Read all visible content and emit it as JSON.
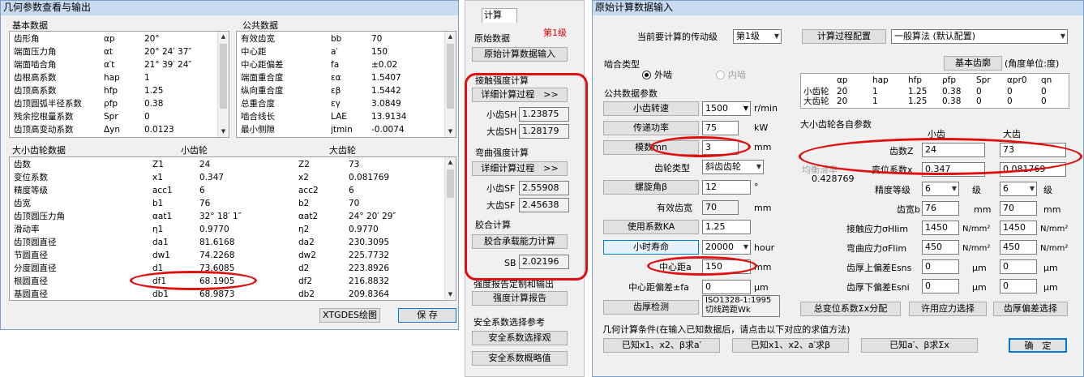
{
  "geo": {
    "title": "几何参数查看与输出",
    "basic_title": "基本数据",
    "basic_rows": [
      [
        "齿形角",
        "αp",
        "20°"
      ],
      [
        "端面压力角",
        "αt",
        "20° 24′ 37″"
      ],
      [
        "端面啮合角",
        "α′t",
        "21° 39′ 24″"
      ],
      [
        "齿根高系数",
        "hap",
        "1"
      ],
      [
        "齿顶高系数",
        "hfp",
        "1.25"
      ],
      [
        "齿顶圆弧半径系数",
        "ρfp",
        "0.38"
      ],
      [
        "残余挖根量系数",
        "Spr",
        "0"
      ],
      [
        "齿顶高变动系数",
        "Δyn",
        "0.0123"
      ]
    ],
    "public_title": "公共数据",
    "public_rows": [
      [
        "有效齿宽",
        "bb",
        "70"
      ],
      [
        "中心距",
        "a′",
        "150"
      ],
      [
        "中心距偏差",
        "fa",
        "±0.02"
      ],
      [
        "端面重合度",
        "εα",
        "1.5407"
      ],
      [
        "纵向重合度",
        "εβ",
        "1.5442"
      ],
      [
        "总重合度",
        "εγ",
        "3.0849"
      ],
      [
        "啮合线长",
        "LAE",
        "13.9134"
      ],
      [
        "最小侧隙",
        "jtmin",
        "-0.0074"
      ]
    ],
    "gear_title": "大小齿轮数据",
    "small_hdr": "小齿轮",
    "large_hdr": "大齿轮",
    "gear_rows": [
      [
        "齿数",
        "Z1",
        "24",
        "Z2",
        "73"
      ],
      [
        "变位系数",
        "x1",
        "0.347",
        "x2",
        "0.081769"
      ],
      [
        "精度等级",
        "acc1",
        "6",
        "acc2",
        "6"
      ],
      [
        "齿宽",
        "b1",
        "76",
        "b2",
        "70"
      ],
      [
        "齿顶圆压力角",
        "αat1",
        "32° 18′ 1″",
        "αat2",
        "24° 20′ 29″"
      ],
      [
        "滑动率",
        "η1",
        "0.9770",
        "η2",
        "0.9770"
      ],
      [
        "齿顶圆直径",
        "da1",
        "81.6168",
        "da2",
        "230.3095"
      ],
      [
        "节圆直径",
        "dw1",
        "74.2268",
        "dw2",
        "225.7732"
      ],
      [
        "分度圆直径",
        "d1",
        "73.6085",
        "d2",
        "223.8926"
      ],
      [
        "根圆直径",
        "df1",
        "68.1905",
        "df2",
        "216.8832"
      ],
      [
        "基圆直径",
        "db1",
        "68.9873",
        "db2",
        "209.8364"
      ]
    ],
    "btn_draw": "XTGDES绘图",
    "btn_save": "保 存"
  },
  "mid": {
    "tab": "计算",
    "level": "第1级",
    "orig_title": "原始数据",
    "orig_btn": "原始计算数据输入",
    "contact_title": "接触强度计算",
    "detail_btn": "详细计算过程　>>",
    "sh_small_lbl": "小齿SH",
    "sh_small": "1.23875",
    "sh_large_lbl": "大齿SH",
    "sh_large": "1.28179",
    "bend_title": "弯曲强度计算",
    "detail_btn2": "详细计算过程　>>",
    "sf_small_lbl": "小齿SF",
    "sf_small": "2.55908",
    "sf_large_lbl": "大齿SF",
    "sf_large": "2.45638",
    "glue_title": "胶合计算",
    "glue_btn": "胶合承载能力计算",
    "sb_lbl": "SB",
    "sb": "2.02196",
    "report_title": "强度报告定制和输出",
    "report_btn": "强度计算报告",
    "safety_title": "安全系数选择参考",
    "safety_btn1": "安全系数选择观",
    "safety_btn2": "安全系数概略值"
  },
  "input": {
    "title": "原始计算数据输入",
    "stage_lbl": "当前要计算的传动级",
    "stage_val": "第1级",
    "config_btn": "计算过程配置",
    "algo_val": "一般算法 (默认配置)",
    "mesh_lbl": "啮合类型",
    "mesh_ext": "外啮",
    "mesh_int": "内啮",
    "rack_btn": "基本齿廓",
    "angle_unit": "(角度单位:度)",
    "rack_hdr": [
      "αp",
      "hap",
      "hfp",
      "ρfp",
      "Spr",
      "αpr0",
      "qn"
    ],
    "rack_small_lbl": "小齿轮",
    "rack_large_lbl": "大齿轮",
    "rack_small": [
      "20",
      "1",
      "1.25",
      "0.38",
      "0",
      "0",
      "0"
    ],
    "rack_large": [
      "20",
      "1",
      "1.25",
      "0.38",
      "0",
      "0",
      "0"
    ],
    "public_title": "公共数据参数",
    "speed_btn": "小齿转速",
    "speed_val": "1500",
    "speed_unit": "r/min",
    "power_btn": "传递功率",
    "power_val": "75",
    "power_unit": "kW",
    "module_btn": "模数mn",
    "module_val": "3",
    "module_unit": "mm",
    "gear_type_lbl": "齿轮类型",
    "gear_type_val": "斜齿齿轮",
    "helix_btn": "螺旋角β",
    "helix_val": "12",
    "helix_unit": "°",
    "face_lbl": "有效齿宽",
    "face_val": "70",
    "face_unit": "mm",
    "ka_btn": "使用系数KA",
    "ka_val": "1.25",
    "life_btn": "小时寿命",
    "life_val": "20000",
    "life_unit": "hour",
    "center_lbl": "中心距a",
    "center_val": "150",
    "center_unit": "mm",
    "center_dev_lbl": "中心距偏差±fa",
    "center_dev_val": "0",
    "center_dev_unit": "μm",
    "thick_btn": "齿厚检测",
    "thick_val": "ISO1328-1:1995 切线跨距Wk",
    "each_title": "大小齿轮各自参数",
    "small_hdr": "小齿",
    "large_hdr": "大齿",
    "teeth_lbl": "齿数Z",
    "teeth_small": "24",
    "teeth_large": "73",
    "balance_lbl": "均衡滑率",
    "balance_val": "0.428769",
    "shift_lbl": "变位系数x",
    "shift_small": "0.347",
    "shift_large": "0.081769",
    "acc_lbl": "精度等级",
    "acc_small": "6",
    "acc_large": "6",
    "acc_unit": "级",
    "width_lbl": "齿宽b",
    "width_small": "76",
    "width_large": "70",
    "width_unit": "mm",
    "hlim_lbl": "接触应力σHlim",
    "hlim_small": "1450",
    "hlim_large": "1450",
    "stress_unit": "N/mm²",
    "flim_lbl": "弯曲应力σFlim",
    "flim_small": "450",
    "flim_large": "450",
    "esns_lbl": "齿厚上偏差Esns",
    "esns_small": "0",
    "esns_large": "0",
    "um": "μm",
    "esni_lbl": "齿厚下偏差Esni",
    "esni_small": "0",
    "esni_large": "0",
    "total_shift_btn": "总变位系数Σx分配",
    "allow_stress_btn": "许用应力选择",
    "thick_dev_btn": "齿厚偏差选择",
    "geo_cond": "几何计算条件(在输入已知数据后，请点击以下对应的求值方法)",
    "cond_btn1": "已知x1、x2、β求a′",
    "cond_btn2": "已知x1、x2、a′求β",
    "cond_btn3": "已知a′、β求Σx",
    "ok_btn": "确　定"
  }
}
